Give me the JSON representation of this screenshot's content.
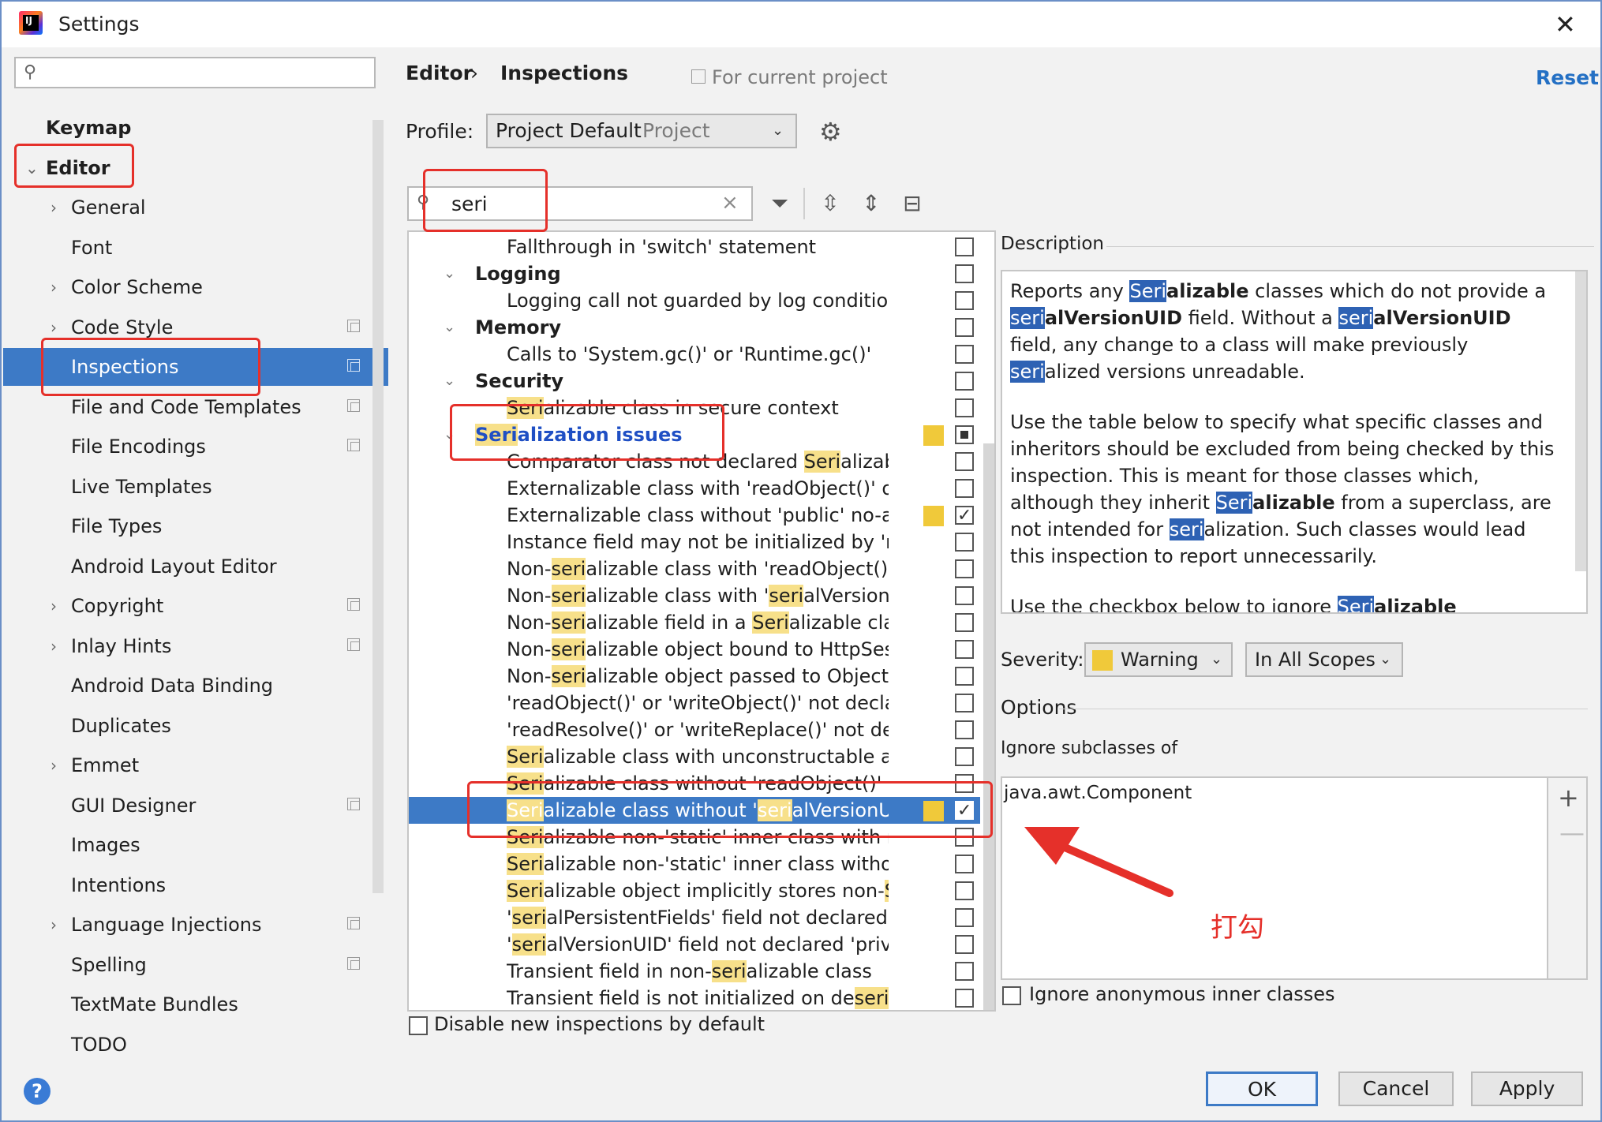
{
  "window": {
    "title": "Settings",
    "close_glyph": "✕"
  },
  "sidebar": {
    "search_placeholder": "",
    "items": [
      {
        "label": "Keymap",
        "level": 0
      },
      {
        "label": "Editor",
        "level": 0,
        "expanded": true
      },
      {
        "label": "General",
        "level": 1,
        "expandable": true
      },
      {
        "label": "Font",
        "level": 1
      },
      {
        "label": "Color Scheme",
        "level": 1,
        "expandable": true
      },
      {
        "label": "Code Style",
        "level": 1,
        "expandable": true,
        "project": true
      },
      {
        "label": "Inspections",
        "level": 1,
        "project": true,
        "selected": true
      },
      {
        "label": "File and Code Templates",
        "level": 1,
        "project": true
      },
      {
        "label": "File Encodings",
        "level": 1,
        "project": true
      },
      {
        "label": "Live Templates",
        "level": 1
      },
      {
        "label": "File Types",
        "level": 1
      },
      {
        "label": "Android Layout Editor",
        "level": 1
      },
      {
        "label": "Copyright",
        "level": 1,
        "expandable": true,
        "project": true
      },
      {
        "label": "Inlay Hints",
        "level": 1,
        "expandable": true,
        "project": true
      },
      {
        "label": "Android Data Binding",
        "level": 1
      },
      {
        "label": "Duplicates",
        "level": 1
      },
      {
        "label": "Emmet",
        "level": 1,
        "expandable": true
      },
      {
        "label": "GUI Designer",
        "level": 1,
        "project": true
      },
      {
        "label": "Images",
        "level": 1
      },
      {
        "label": "Intentions",
        "level": 1
      },
      {
        "label": "Language Injections",
        "level": 1,
        "expandable": true,
        "project": true
      },
      {
        "label": "Spelling",
        "level": 1,
        "project": true
      },
      {
        "label": "TextMate Bundles",
        "level": 1
      },
      {
        "label": "TODO",
        "level": 1
      }
    ]
  },
  "header": {
    "crumb_editor": "Editor",
    "crumb_sep": "›",
    "crumb_inspections": "Inspections",
    "for_current_project": "For current project",
    "reset": "Reset"
  },
  "profile": {
    "label": "Profile:",
    "value": "Project Default",
    "scope": "Project"
  },
  "search": {
    "value": "seri"
  },
  "tree": [
    {
      "text": "Fallthrough in 'switch' statement",
      "type": "item",
      "check": "off"
    },
    {
      "text": "Logging",
      "type": "group",
      "check": "off"
    },
    {
      "text": "Logging call not guarded by log condition",
      "type": "item",
      "check": "off"
    },
    {
      "text": "Memory",
      "type": "group",
      "check": "off"
    },
    {
      "text": "Calls to 'System.gc()' or 'Runtime.gc()'",
      "type": "item",
      "check": "off"
    },
    {
      "text": "Security",
      "type": "group",
      "check": "off"
    },
    {
      "text": "Serializable class in secure context",
      "type": "item",
      "check": "off"
    },
    {
      "text": "Serialization issues",
      "type": "group",
      "check": "mixed",
      "sev": true,
      "hl": true
    },
    {
      "text": "Comparator class not declared Serializable",
      "type": "item",
      "check": "off"
    },
    {
      "text": "Externalizable class with 'readObject()' or 'writ",
      "type": "item",
      "check": "off"
    },
    {
      "text": "Externalizable class without 'public' no-arg co",
      "type": "item",
      "check": "on",
      "sev": true
    },
    {
      "text": "Instance field may not be initialized by 'readC",
      "type": "item",
      "check": "off"
    },
    {
      "text": "Non-serializable class with 'readObject()' or 'w",
      "type": "item",
      "check": "off"
    },
    {
      "text": "Non-serializable class with 'serialVersionUID'",
      "type": "item",
      "check": "off"
    },
    {
      "text": "Non-serializable field in a Serializable class",
      "type": "item",
      "check": "off"
    },
    {
      "text": "Non-serializable object bound to HttpSession",
      "type": "item",
      "check": "off"
    },
    {
      "text": "Non-serializable object passed to ObjectOutp",
      "type": "item",
      "check": "off"
    },
    {
      "text": "'readObject()' or 'writeObject()' not declared '",
      "type": "item",
      "check": "off"
    },
    {
      "text": "'readResolve()' or 'writeReplace()' not declare",
      "type": "item",
      "check": "off"
    },
    {
      "text": "Serializable class with unconstructable ancest",
      "type": "item",
      "check": "off"
    },
    {
      "text": "Serializable class without 'readObject()' and 'w",
      "type": "item",
      "check": "off"
    },
    {
      "text": "Serializable class without 'serialVersionUID'",
      "type": "item",
      "check": "on",
      "sev": true,
      "selected": true
    },
    {
      "text": "Serializable non-'static' inner class with non-S",
      "type": "item",
      "check": "off"
    },
    {
      "text": "Serializable non-'static' inner class without 'se",
      "type": "item",
      "check": "off"
    },
    {
      "text": "Serializable object implicitly stores non-Seriali",
      "type": "item",
      "check": "off"
    },
    {
      "text": "'serialPersistentFields' field not declared 'priva",
      "type": "item",
      "check": "off"
    },
    {
      "text": "'serialVersionUID' field not declared 'private s",
      "type": "item",
      "check": "off"
    },
    {
      "text": "Transient field in non-serializable class",
      "type": "item",
      "check": "off"
    },
    {
      "text": "Transient field is not initialized on deserializat",
      "type": "item",
      "check": "off"
    }
  ],
  "description": {
    "label": "Description",
    "p1": "Reports any Serializable classes which do not provide a serialVersionUID field. Without a serialVersionUID field, any change to a class will make previously serialized versions unreadable.",
    "p2": "Use the table below to specify what specific classes and inheritors should be excluded from being checked by this inspection. This is meant for those classes which, although they inherit Serializable from a superclass, are not intended for serialization. Such classes would lead this inspection to report unnecessarily.",
    "p3": "Use the checkbox below to ignore Serializable anonymous"
  },
  "severity": {
    "label": "Severity:",
    "value": "Warning",
    "color": "#f0c93a",
    "scope": "In All Scopes"
  },
  "options": {
    "label": "Options",
    "ignore_label": "Ignore subclasses of",
    "subclasses": [
      "java.awt.Component"
    ],
    "anon_label": "Ignore anonymous inner classes",
    "add": "+",
    "remove": "—"
  },
  "disable_new": "Disable new inspections by default",
  "annotation_text": "打勾",
  "buttons": {
    "help": "?",
    "ok": "OK",
    "cancel": "Cancel",
    "apply": "Apply"
  },
  "colors": {
    "selection": "#3d7ac6",
    "accent": "#2470c4",
    "annotation": "#e5302a",
    "warning": "#f0c93a"
  }
}
